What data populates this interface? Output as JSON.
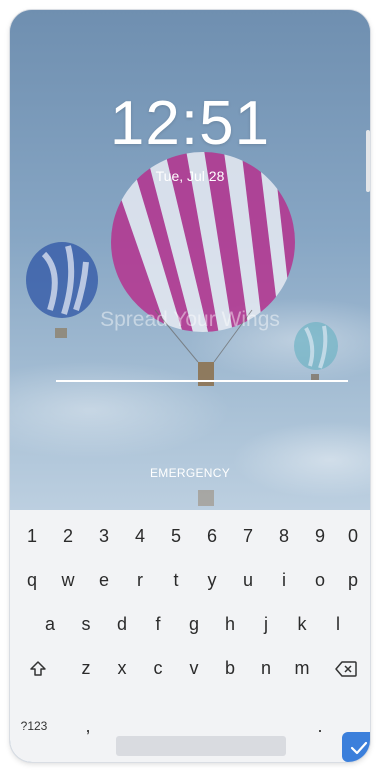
{
  "lockscreen": {
    "time": "12:51",
    "date": "Tue, Jul 28",
    "owner_message": "Spread Your Wings",
    "emergency_label": "EMERGENCY"
  },
  "keyboard": {
    "row_numbers": [
      "1",
      "2",
      "3",
      "4",
      "5",
      "6",
      "7",
      "8",
      "9",
      "0"
    ],
    "row_top": [
      "q",
      "w",
      "e",
      "r",
      "t",
      "y",
      "u",
      "i",
      "o",
      "p"
    ],
    "row_middle": [
      "a",
      "s",
      "d",
      "f",
      "g",
      "h",
      "j",
      "k",
      "l"
    ],
    "row_bottom": [
      "z",
      "x",
      "c",
      "v",
      "b",
      "n",
      "m"
    ],
    "symbols_label": "?123",
    "comma_label": ",",
    "period_label": ".",
    "shift_icon": "shift-icon",
    "backspace_icon": "backspace-icon",
    "enter_icon": "check-icon"
  },
  "colors": {
    "accent": "#3b7fdb",
    "keyboard_bg": "#f2f3f5"
  }
}
